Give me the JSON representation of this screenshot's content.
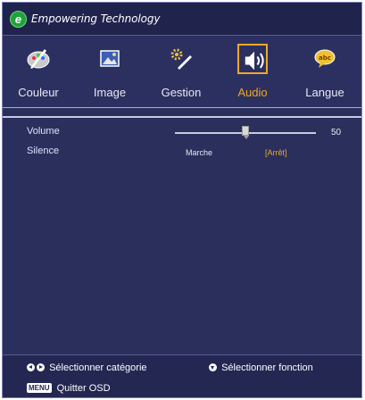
{
  "brand": {
    "logo_letter": "e",
    "tagline": "Empowering Technology"
  },
  "tabs": [
    {
      "id": "couleur",
      "label": "Couleur",
      "icon": "palette-icon",
      "active": false
    },
    {
      "id": "image",
      "label": "Image",
      "icon": "picture-icon",
      "active": false
    },
    {
      "id": "gestion",
      "label": "Gestion",
      "icon": "tools-icon",
      "active": false
    },
    {
      "id": "audio",
      "label": "Audio",
      "icon": "speaker-icon",
      "active": true
    },
    {
      "id": "langue",
      "label": "Langue",
      "icon": "speech-bubble-icon",
      "active": false
    }
  ],
  "audio": {
    "volume": {
      "label": "Volume",
      "value": "50",
      "fraction": 0.5
    },
    "silence": {
      "label": "Silence",
      "option_on": "Marche",
      "option_off": "[Arrêt]",
      "selected": "off"
    }
  },
  "footer": {
    "select_category": "Sélectionner catégorie",
    "select_function": "Sélectionner fonction",
    "menu_key": "MENU",
    "quit": "Quitter OSD"
  },
  "colors": {
    "background": "#2a2f5c",
    "accent": "#f0a726",
    "text": "#e8e8f4"
  }
}
